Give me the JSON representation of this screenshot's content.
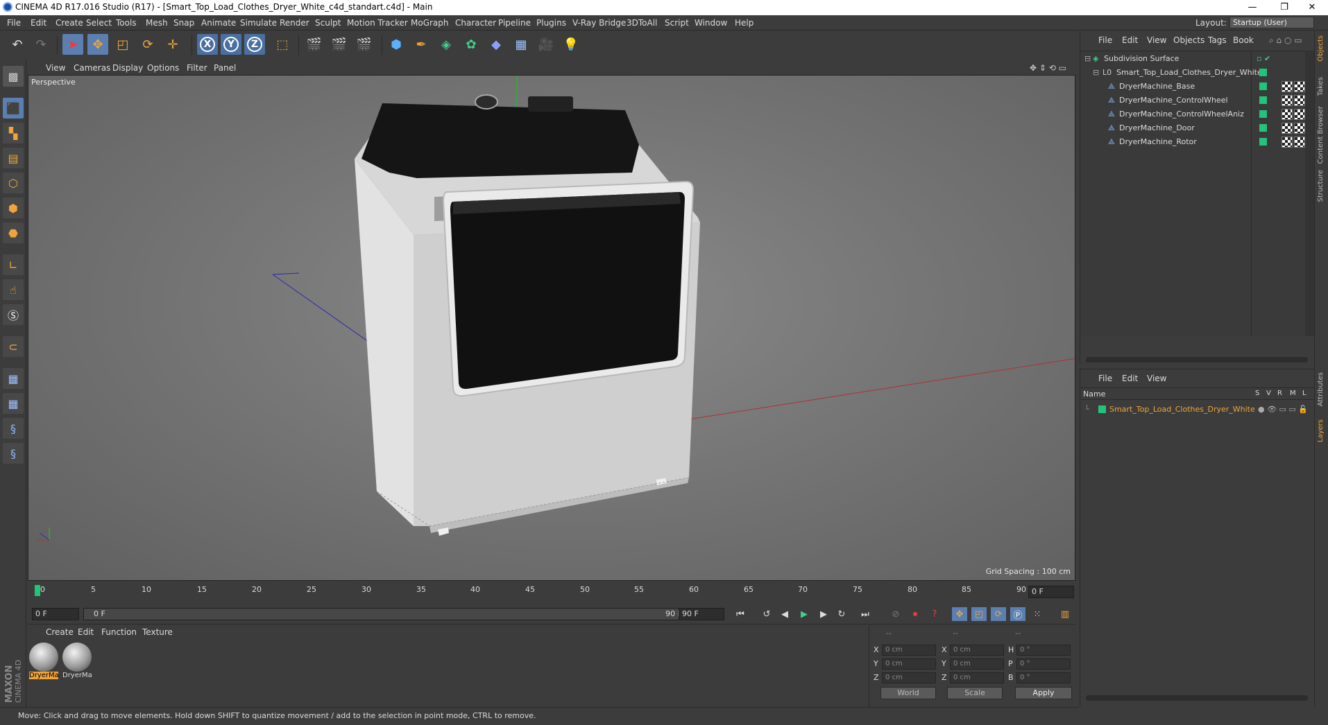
{
  "window": {
    "title": "CINEMA 4D R17.016 Studio (R17) - [Smart_Top_Load_Clothes_Dryer_White_c4d_standart.c4d] - Main",
    "minimize": "—",
    "restore": "❐",
    "close": "✕"
  },
  "menubar": {
    "items": [
      "File",
      "Edit",
      "Create",
      "Select",
      "Tools",
      "Mesh",
      "Snap",
      "Animate",
      "Simulate",
      "Render",
      "Sculpt",
      "Motion Tracker",
      "MoGraph",
      "Character",
      "Pipeline",
      "Plugins",
      "V-Ray Bridge",
      "3DToAll",
      "Script",
      "Window",
      "Help"
    ],
    "layout_label": "Layout:",
    "layout_value": "Startup (User)"
  },
  "toolbar": {
    "axis_x": "X",
    "axis_y": "Y",
    "axis_z": "Z"
  },
  "viewport": {
    "menu": [
      "View",
      "Cameras",
      "Display",
      "Options",
      "Filter",
      "Panel"
    ],
    "label": "Perspective",
    "grid_spacing": "Grid Spacing : 100 cm"
  },
  "timeline": {
    "ticks": [
      "0",
      "5",
      "10",
      "15",
      "20",
      "25",
      "30",
      "35",
      "40",
      "45",
      "50",
      "55",
      "60",
      "65",
      "70",
      "75",
      "80",
      "85",
      "90"
    ],
    "current_frame": "0 F"
  },
  "transport": {
    "start_field": "0 F",
    "range_start": "0 F",
    "range_end": "90 F",
    "end_field": "90 F"
  },
  "materials": {
    "menu": [
      "Create",
      "Edit",
      "Function",
      "Texture"
    ],
    "items": [
      {
        "label": "DryerMa",
        "selected": true
      },
      {
        "label": "DryerMa",
        "selected": false
      }
    ]
  },
  "coordinates": {
    "header": [
      "--",
      "--",
      "--"
    ],
    "rows": [
      {
        "a": "X",
        "av": "0 cm",
        "b": "X",
        "bv": "0 cm",
        "c": "H",
        "cv": "0 °"
      },
      {
        "a": "Y",
        "av": "0 cm",
        "b": "Y",
        "bv": "0 cm",
        "c": "P",
        "cv": "0 °"
      },
      {
        "a": "Z",
        "av": "0 cm",
        "b": "Z",
        "bv": "0 cm",
        "c": "B",
        "cv": "0 °"
      }
    ],
    "space": "World",
    "mode": "Scale",
    "apply": "Apply"
  },
  "status": {
    "text": "Move: Click and drag to move elements. Hold down SHIFT to quantize movement / add to the selection in point mode, CTRL to remove."
  },
  "branding": {
    "maxon": "MAXON",
    "product": "CINEMA 4D"
  },
  "objects_panel": {
    "menu": [
      "File",
      "Edit",
      "View",
      "Objects",
      "Tags",
      "Book"
    ],
    "items": [
      {
        "label": "Subdivision Surface",
        "indent": 0
      },
      {
        "label": "Smart_Top_Load_Clothes_Dryer_White",
        "indent": 1
      },
      {
        "label": "DryerMachine_Base",
        "indent": 2
      },
      {
        "label": "DryerMachine_ControlWheel",
        "indent": 2
      },
      {
        "label": "DryerMachine_ControlWheelAniz",
        "indent": 2
      },
      {
        "label": "DryerMachine_Door",
        "indent": 2
      },
      {
        "label": "DryerMachine_Rotor",
        "indent": 2
      }
    ]
  },
  "layers_panel": {
    "menu": [
      "File",
      "Edit",
      "View"
    ],
    "header_name": "Name",
    "header_cols": [
      "S",
      "V",
      "R",
      "M",
      "L"
    ],
    "items": [
      {
        "label": "Smart_Top_Load_Clothes_Dryer_White",
        "color": "#22c47a"
      }
    ]
  },
  "right_tabs": [
    "Objects",
    "Takes",
    "Content Browser",
    "Structure",
    "Attributes",
    "Layers"
  ],
  "colors": {
    "accent_orange": "#f0a53a",
    "selection_blue": "#5a7fb0",
    "layer_green": "#22c47a"
  }
}
